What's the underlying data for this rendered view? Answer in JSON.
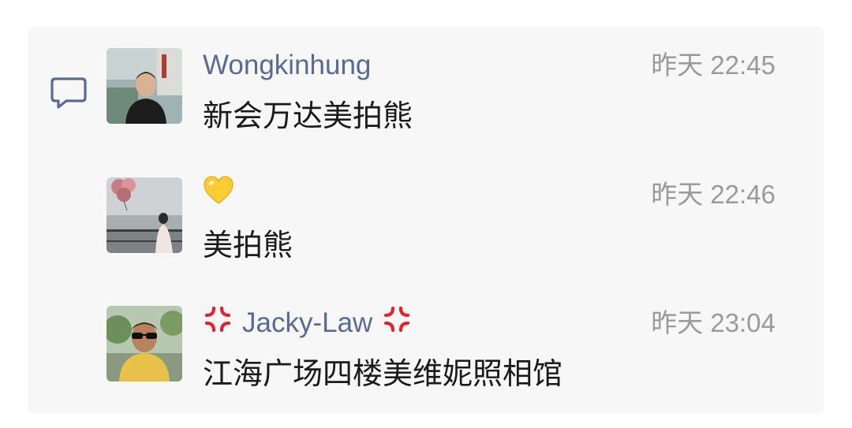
{
  "comments": [
    {
      "name": "Wongkinhung",
      "time": "昨天 22:45",
      "message": "新会万达美拍熊"
    },
    {
      "name_emoji": "yellow-heart-emoji",
      "time": "昨天 22:46",
      "message": "美拍熊"
    },
    {
      "name": "Jacky-Law",
      "name_prefix_emoji": "anger-symbol-emoji",
      "name_suffix_emoji": "anger-symbol-emoji",
      "time": "昨天 23:04",
      "message": "江海广场四楼美维妮照相馆"
    }
  ],
  "colors": {
    "name": "#576b95",
    "time": "#9a9a9a",
    "message": "#1a1a1a",
    "panel": "#f7f7f7",
    "anger": "#e0242f",
    "heart": "#ffcc33"
  },
  "icons": {
    "section_icon": "comment-bubble-icon"
  }
}
